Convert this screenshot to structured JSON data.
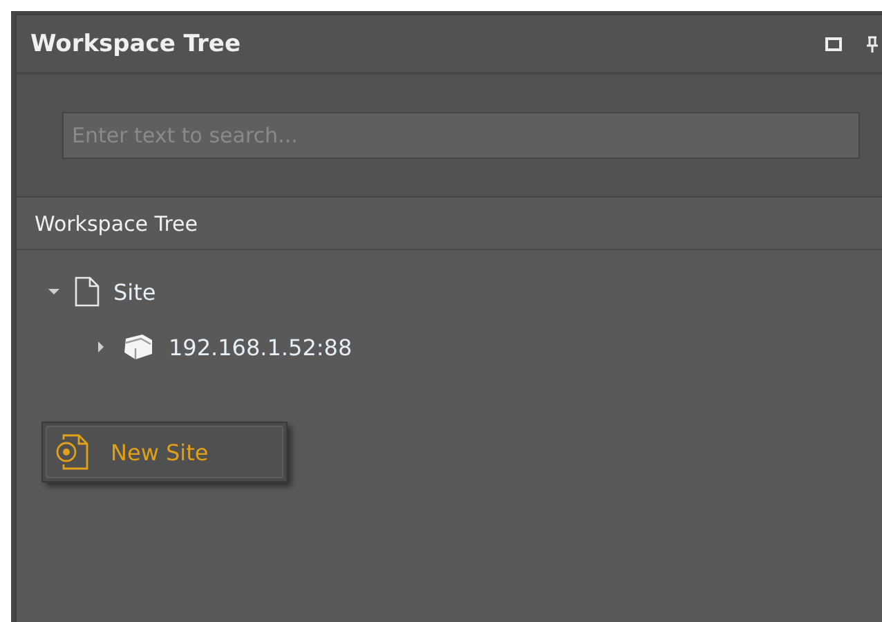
{
  "panel": {
    "title": "Workspace Tree"
  },
  "search": {
    "placeholder": "Enter text to search..."
  },
  "tree": {
    "header": "Workspace Tree",
    "items": [
      {
        "label": "Site",
        "kind": "site",
        "expanded": true,
        "children": [
          {
            "label": "192.168.1.52:88",
            "kind": "server",
            "expanded": false
          }
        ]
      }
    ]
  },
  "context_menu": {
    "items": [
      {
        "label": "New Site"
      }
    ]
  }
}
